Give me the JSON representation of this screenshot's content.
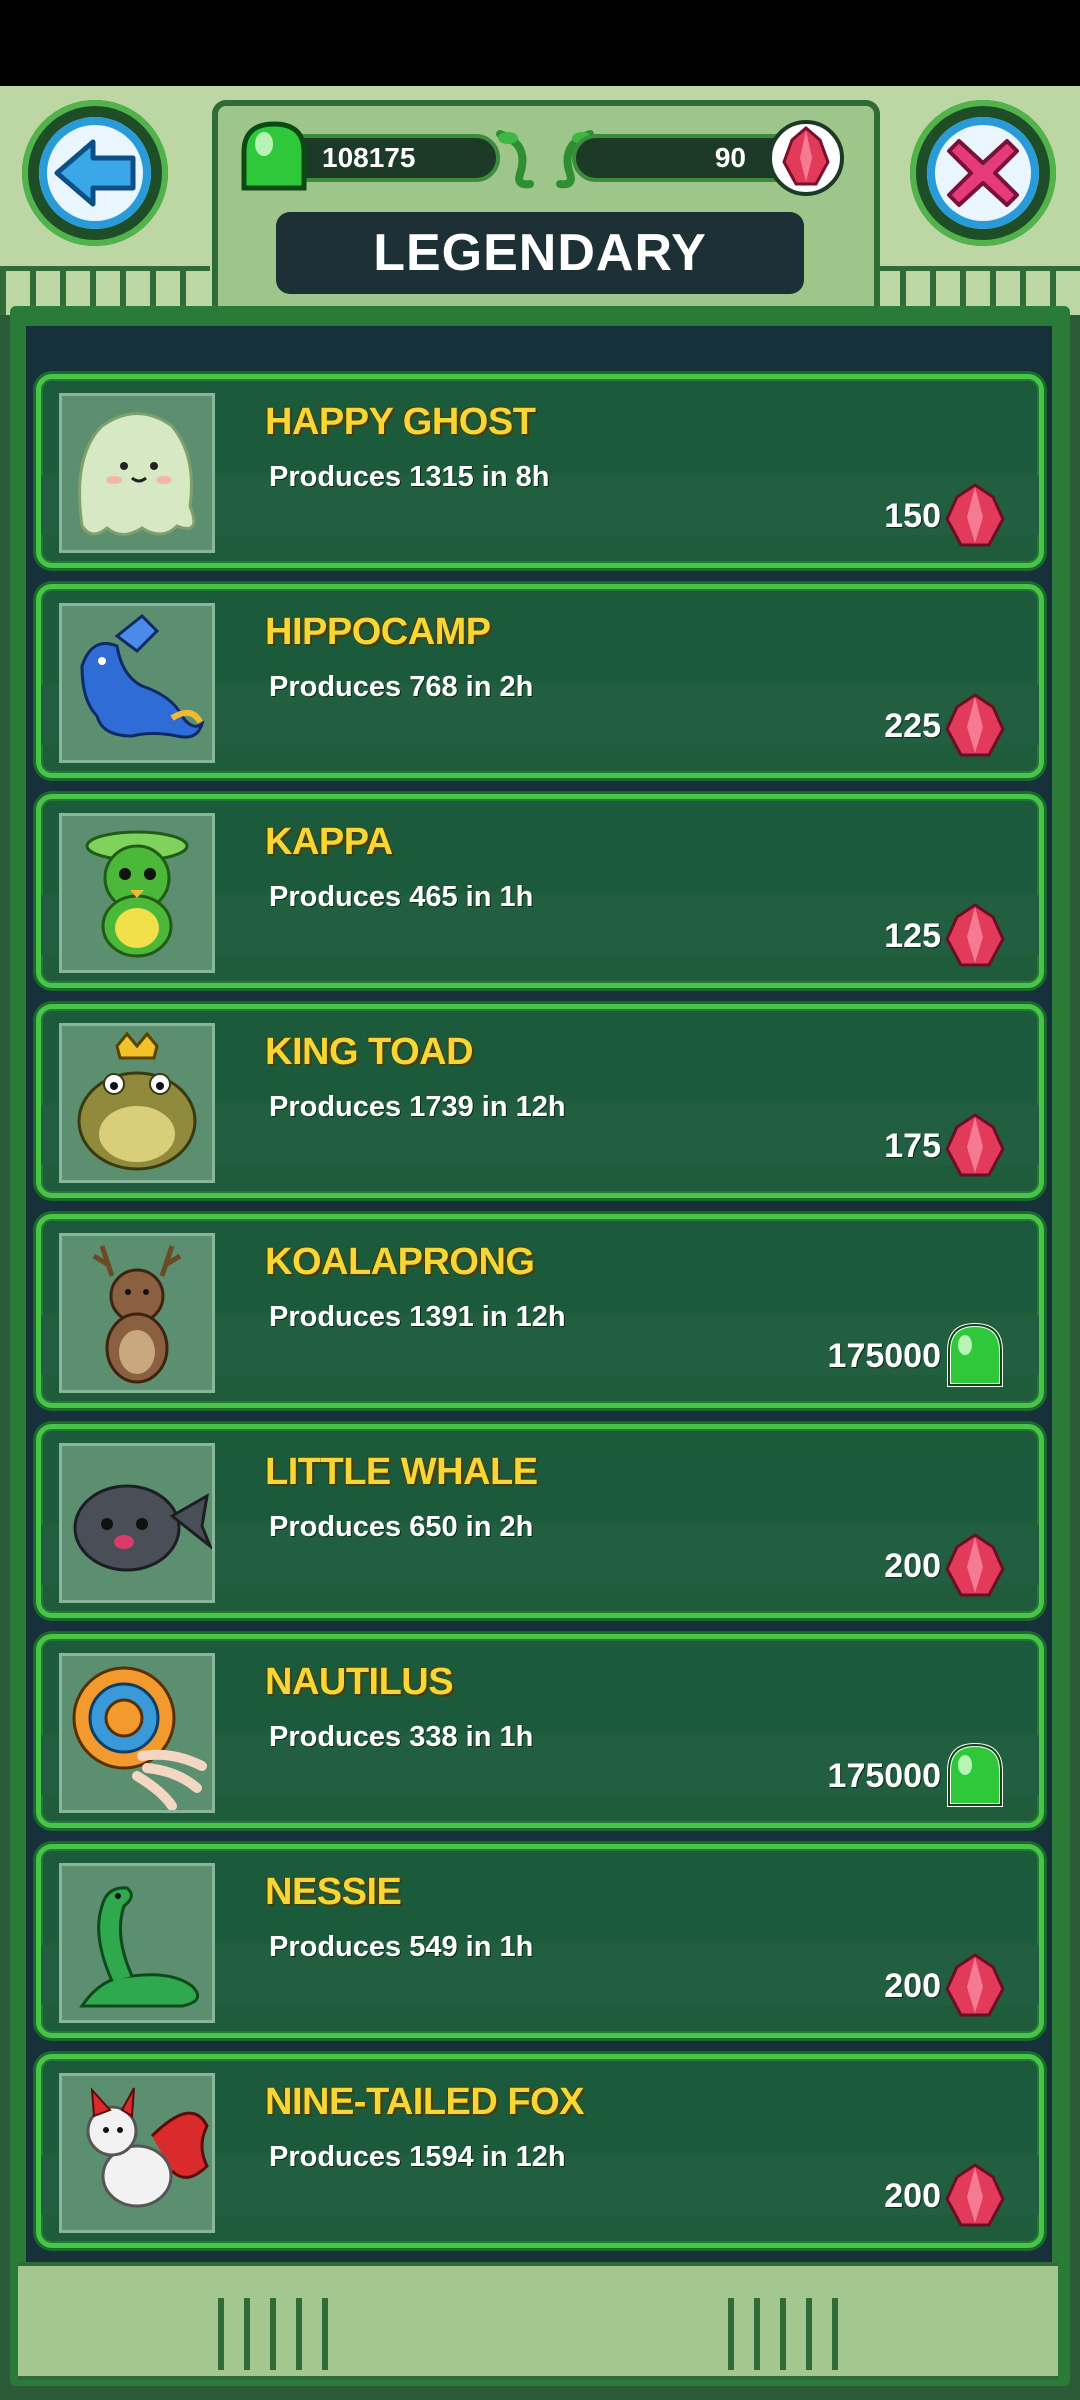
{
  "header": {
    "jelly_count": "108175",
    "gem_count": "90",
    "title": "LEGENDARY"
  },
  "monsters": [
    {
      "name": "HAPPY GHOST",
      "produces": "Produces 1315 in 8h",
      "price": "150",
      "currency": "gem-icon"
    },
    {
      "name": "HIPPOCAMP",
      "produces": "Produces 768 in 2h",
      "price": "225",
      "currency": "gem-icon"
    },
    {
      "name": "KAPPA",
      "produces": "Produces 465 in 1h",
      "price": "125",
      "currency": "gem-icon"
    },
    {
      "name": "KING TOAD",
      "produces": "Produces 1739 in 12h",
      "price": "175",
      "currency": "gem-icon"
    },
    {
      "name": "KOALAPRONG",
      "produces": "Produces 1391 in 12h",
      "price": "175000",
      "currency": "jelly-icon"
    },
    {
      "name": "LITTLE WHALE",
      "produces": "Produces 650 in 2h",
      "price": "200",
      "currency": "gem-icon"
    },
    {
      "name": "NAUTILUS",
      "produces": "Produces 338 in 1h",
      "price": "175000",
      "currency": "jelly-icon"
    },
    {
      "name": "NESSIE",
      "produces": "Produces 549 in 1h",
      "price": "200",
      "currency": "gem-icon"
    },
    {
      "name": "NINE-TAILED FOX",
      "produces": "Produces 1594 in 12h",
      "price": "200",
      "currency": "gem-icon"
    }
  ],
  "colors": {
    "name_yellow": "#f6d735",
    "card_border": "#48c548",
    "gem_red": "#e23a5a",
    "jelly_green": "#39d23c"
  }
}
